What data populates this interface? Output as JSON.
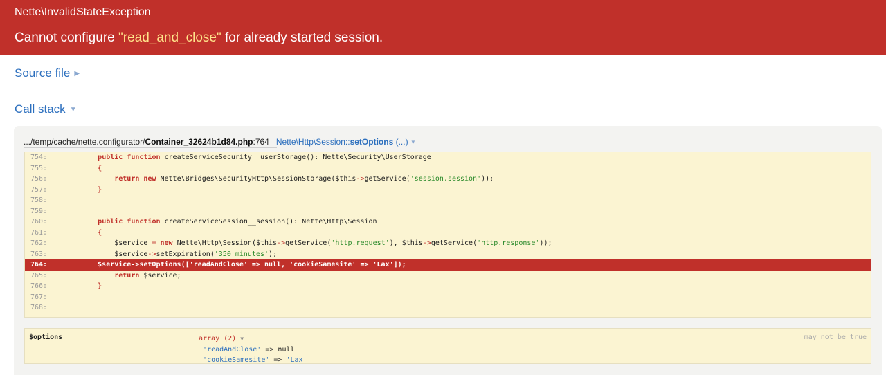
{
  "header": {
    "exception_class": "Nette\\InvalidStateException",
    "message_prefix": "Cannot configure ",
    "message_quoted": "\"read_and_close\"",
    "message_suffix": " for already started session."
  },
  "sections": {
    "source_file": "Source file",
    "call_stack": "Call stack"
  },
  "frame": {
    "file_prefix": ".../temp/cache/nette.configurator/",
    "file_name": "Container_32624b1d84.php",
    "file_line": ":764",
    "fn_class": "Nette\\Http\\Session::",
    "fn_name": "setOptions",
    "fn_args": " (...)"
  },
  "code_lines": [
    {
      "n": "754:",
      "t": ""
    },
    {
      "n": "755:",
      "t": ""
    },
    {
      "n": "756:",
      "t": ""
    },
    {
      "n": "757:",
      "t": ""
    },
    {
      "n": "758:",
      "t": ""
    },
    {
      "n": "759:",
      "t": ""
    },
    {
      "n": "760:",
      "t": ""
    },
    {
      "n": "761:",
      "t": ""
    },
    {
      "n": "762:",
      "t": ""
    },
    {
      "n": "763:",
      "t": ""
    },
    {
      "n": "764:",
      "t": "        $service->setOptions(['readAndClose' => null, 'cookieSamesite' => 'Lax']);"
    },
    {
      "n": "765:",
      "t": ""
    },
    {
      "n": "766:",
      "t": ""
    },
    {
      "n": "767:",
      "t": ""
    },
    {
      "n": "768:",
      "t": ""
    }
  ],
  "variables": {
    "name": "$options",
    "array_label": "array (2)",
    "key1": "'readAndClose'",
    "arrow1": " => ",
    "val1": "null",
    "key2": "'cookieSamesite'",
    "arrow2": " => ",
    "val2": "'Lax'",
    "note": "may not be true"
  },
  "colors": {
    "header_bg": "#c0302a",
    "link": "#2c6fbe",
    "code_bg": "#fbf4d2",
    "highlight": "#c0302a"
  }
}
